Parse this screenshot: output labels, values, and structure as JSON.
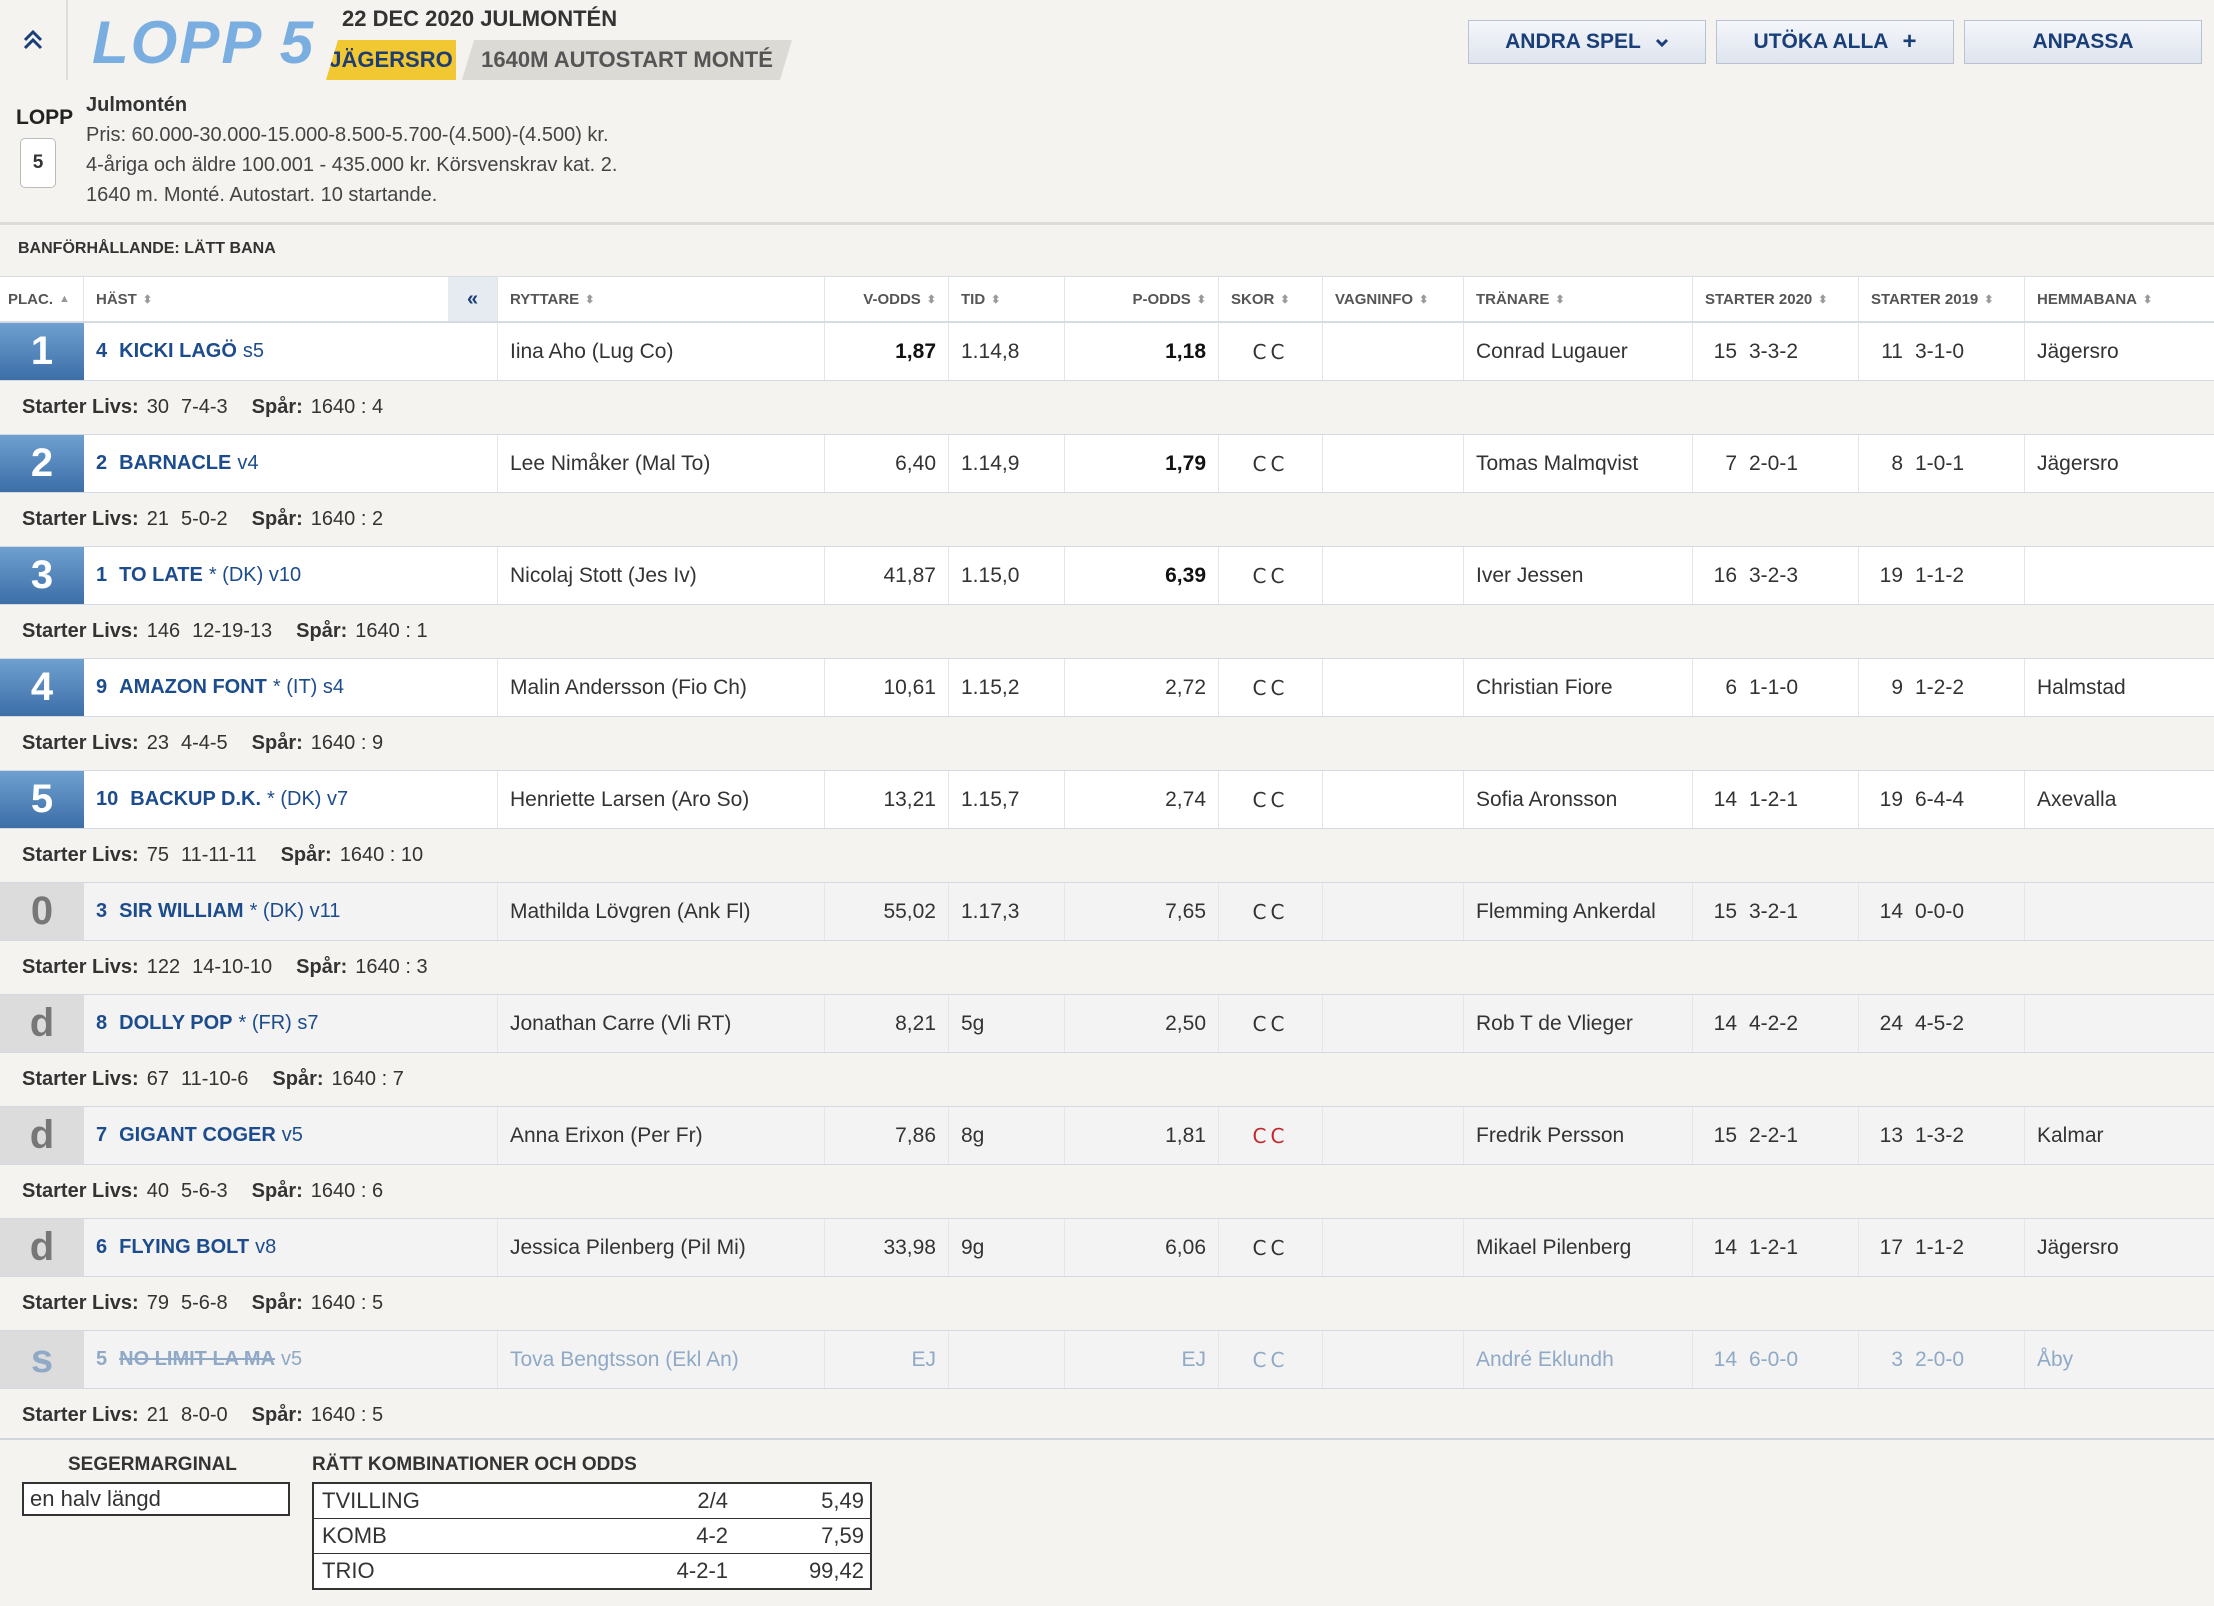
{
  "header": {
    "title": "LOPP 5",
    "date_line": "22 DEC 2020 JULMONTÉN",
    "track": "JÄGERSRO",
    "distance": "1640M AUTOSTART MONTÉ",
    "buttons": {
      "andra_spel": "ANDRA SPEL",
      "utoka": "UTÖKA ALLA",
      "anpassa": "ANPASSA"
    }
  },
  "race_info": {
    "lopp_label": "LOPP",
    "lopp_number": "5",
    "name": "Julmontén",
    "lines": [
      "Pris: 60.000-30.000-15.000-8.500-5.700-(4.500)-(4.500) kr.",
      "4-åriga och äldre 100.001 - 435.000 kr. Körsvenskrav kat. 2.",
      "1640 m. Monté. Autostart. 10 startande."
    ]
  },
  "track_condition": "BANFÖRHÅLLANDE: LÄTT BANA",
  "columns": {
    "plac": "PLAC.",
    "hast": "HÄST",
    "ryttare": "RYTTARE",
    "v_odds": "V-ODDS",
    "tid": "TID",
    "p_odds": "P-ODDS",
    "skor": "SKOR",
    "vagninfo": "VAGNINFO",
    "tranare": "TRÄNARE",
    "starter2020": "STARTER 2020",
    "starter2019": "STARTER 2019",
    "hemmabana": "HEMMABANA",
    "collapse": "«"
  },
  "labels": {
    "starter_livs": "Starter Livs:",
    "spar": "Spår:"
  },
  "rows": [
    {
      "plac": "1",
      "nr": "4",
      "name": "KICKI LAGÖ",
      "extra": "s5",
      "ryttare": "Iina Aho (Lug Co)",
      "v_odds": "1,87",
      "tid": "1.14,8",
      "p_odds": "1,18",
      "skor": "CC",
      "tranare": "Conrad Lugauer",
      "s2020n": "15",
      "s2020": "3-3-2",
      "s2019n": "11",
      "s2019": "3-1-0",
      "hemma": "Jägersro",
      "livs": "30",
      "livs_res": "7-4-3",
      "spar": "1640 : 4"
    },
    {
      "plac": "2",
      "nr": "2",
      "name": "BARNACLE",
      "extra": "v4",
      "ryttare": "Lee Nimåker (Mal To)",
      "v_odds": "6,40",
      "tid": "1.14,9",
      "p_odds": "1,79",
      "skor": "CC",
      "tranare": "Tomas Malmqvist",
      "s2020n": "7",
      "s2020": "2-0-1",
      "s2019n": "8",
      "s2019": "1-0-1",
      "hemma": "Jägersro",
      "livs": "21",
      "livs_res": "5-0-2",
      "spar": "1640 : 2"
    },
    {
      "plac": "3",
      "nr": "1",
      "name": "TO LATE",
      "extra": "* (DK)  v10",
      "ryttare": "Nicolaj Stott (Jes Iv)",
      "v_odds": "41,87",
      "tid": "1.15,0",
      "p_odds": "6,39",
      "skor": "CC",
      "tranare": "Iver Jessen",
      "s2020n": "16",
      "s2020": "3-2-3",
      "s2019n": "19",
      "s2019": "1-1-2",
      "hemma": "",
      "livs": "146",
      "livs_res": "12-19-13",
      "spar": "1640 : 1"
    },
    {
      "plac": "4",
      "nr": "9",
      "name": "AMAZON FONT",
      "extra": "* (IT)  s4",
      "ryttare": "Malin Andersson (Fio Ch)",
      "v_odds": "10,61",
      "tid": "1.15,2",
      "p_odds": "2,72",
      "skor": "CC",
      "tranare": "Christian Fiore",
      "s2020n": "6",
      "s2020": "1-1-0",
      "s2019n": "9",
      "s2019": "1-2-2",
      "hemma": "Halmstad",
      "livs": "23",
      "livs_res": "4-4-5",
      "spar": "1640 : 9"
    },
    {
      "plac": "5",
      "nr": "10",
      "name": "BACKUP D.K.",
      "extra": "* (DK)  v7",
      "ryttare": "Henriette Larsen (Aro So)",
      "v_odds": "13,21",
      "tid": "1.15,7",
      "p_odds": "2,74",
      "skor": "CC",
      "tranare": "Sofia Aronsson",
      "s2020n": "14",
      "s2020": "1-2-1",
      "s2019n": "19",
      "s2019": "6-4-4",
      "hemma": "Axevalla",
      "livs": "75",
      "livs_res": "11-11-11",
      "spar": "1640 : 10"
    },
    {
      "plac": "0",
      "nr": "3",
      "name": "SIR WILLIAM",
      "extra": "* (DK)  v11",
      "ryttare": "Mathilda Lövgren (Ank Fl)",
      "v_odds": "55,02",
      "tid": "1.17,3",
      "p_odds": "7,65",
      "skor": "CC",
      "tranare": "Flemming Ankerdal",
      "s2020n": "15",
      "s2020": "3-2-1",
      "s2019n": "14",
      "s2019": "0-0-0",
      "hemma": "",
      "livs": "122",
      "livs_res": "14-10-10",
      "spar": "1640 : 3"
    },
    {
      "plac": "d",
      "nr": "8",
      "name": "DOLLY POP",
      "extra": "* (FR)  s7",
      "ryttare": "Jonathan Carre (Vli RT)",
      "v_odds": "8,21",
      "tid": "5g",
      "p_odds": "2,50",
      "skor": "CC",
      "tranare": "Rob T de Vlieger",
      "s2020n": "14",
      "s2020": "4-2-2",
      "s2019n": "24",
      "s2019": "4-5-2",
      "hemma": "",
      "livs": "67",
      "livs_res": "11-10-6",
      "spar": "1640 : 7"
    },
    {
      "plac": "d",
      "nr": "7",
      "name": "GIGANT COGER",
      "extra": "v5",
      "ryttare": "Anna Erixon (Per Fr)",
      "v_odds": "7,86",
      "tid": "8g",
      "p_odds": "1,81",
      "skor": "CC",
      "skor_color": "#c0282e",
      "tranare": "Fredrik Persson",
      "s2020n": "15",
      "s2020": "2-2-1",
      "s2019n": "13",
      "s2019": "1-3-2",
      "hemma": "Kalmar",
      "livs": "40",
      "livs_res": "5-6-3",
      "spar": "1640 : 6"
    },
    {
      "plac": "d",
      "nr": "6",
      "name": "FLYING BOLT",
      "extra": "v8",
      "ryttare": "Jessica Pilenberg (Pil Mi)",
      "v_odds": "33,98",
      "tid": "9g",
      "p_odds": "6,06",
      "skor": "CC",
      "tranare": "Mikael Pilenberg",
      "s2020n": "14",
      "s2020": "1-2-1",
      "s2019n": "17",
      "s2019": "1-1-2",
      "hemma": "Jägersro",
      "livs": "79",
      "livs_res": "5-6-8",
      "spar": "1640 : 5"
    },
    {
      "plac": "s",
      "nr": "5",
      "name": "NO LIMIT LA MA",
      "extra": "v5",
      "ryttare": "Tova Bengtsson (Ekl An)",
      "v_odds": "EJ",
      "tid": "",
      "p_odds": "EJ",
      "skor": "CC",
      "tranare": "André Eklundh",
      "s2020n": "14",
      "s2020": "6-0-0",
      "s2019n": "3",
      "s2019": "2-0-0",
      "hemma": "Åby",
      "livs": "21",
      "livs_res": "8-0-0",
      "spar": "1640 : 5"
    }
  ],
  "footer": {
    "segermarginal_title": "SEGERMARGINAL",
    "segermarginal": "en halv längd",
    "combos_title": "RÄTT KOMBINATIONER OCH ODDS",
    "combos": [
      {
        "name": "TVILLING",
        "combo": "2/4",
        "odds": "5,49"
      },
      {
        "name": "KOMB",
        "combo": "4-2",
        "odds": "7,59"
      },
      {
        "name": "TRIO",
        "combo": "4-2-1",
        "odds": "99,42"
      }
    ]
  },
  "colors": {
    "accent": "#1d4c8c",
    "track_badge": "#f2c832",
    "title": "#7aaee0",
    "shoe_red": "#c0282e"
  }
}
